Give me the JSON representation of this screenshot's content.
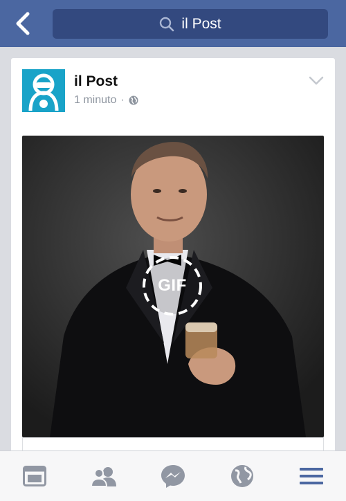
{
  "search": {
    "query": "il Post"
  },
  "post": {
    "author": "il Post",
    "time": "1 minuto",
    "separator": "·",
    "media_badge": "GIF"
  },
  "icons": {
    "back": "chevron-left-icon",
    "search": "magnifier-icon",
    "privacy": "globe-icon",
    "options": "chevron-down-icon",
    "tabs": [
      "news-feed-icon",
      "friends-icon",
      "messenger-icon",
      "notifications-globe-icon",
      "menu-icon"
    ]
  },
  "colors": {
    "header": "#4b67a1",
    "search_box": "#33497f",
    "brand_avatar": "#19a3c8",
    "tab_inactive": "#9197a3",
    "tab_active": "#4b67a1"
  }
}
